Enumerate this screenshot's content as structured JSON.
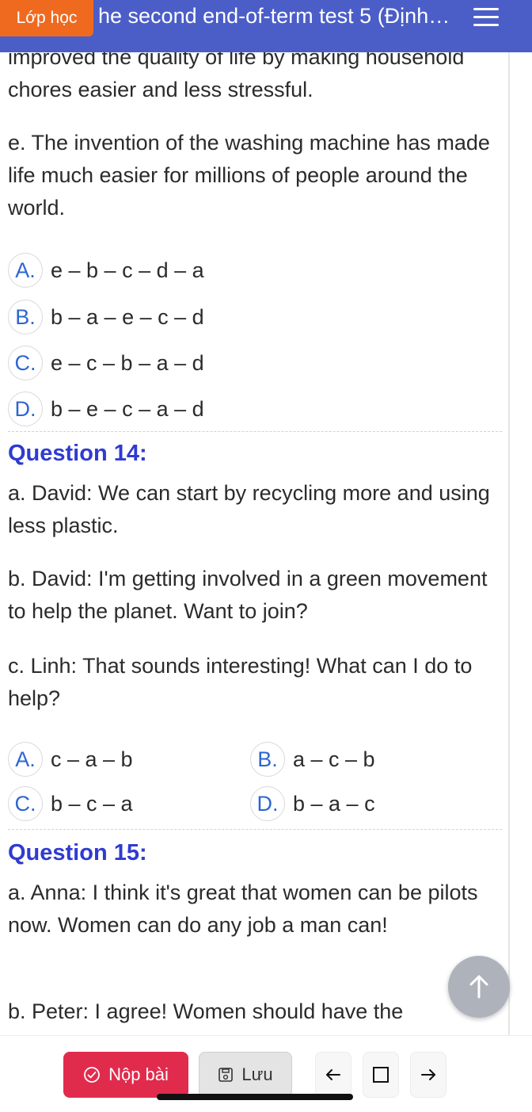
{
  "header": {
    "badge": "Lớp học",
    "title": "he second end-of-term test 5 (Định…"
  },
  "prev_paragraphs": [
    "improved the quality of life by making household chores easier and less stressful.",
    "e. The invention of the washing machine has made life much easier for millions of people around the world."
  ],
  "question13_options": [
    {
      "letter": "A.",
      "text": "e – b – c – d – a"
    },
    {
      "letter": "B.",
      "text": "b – a – e – c – d"
    },
    {
      "letter": "C.",
      "text": "e – c – b – a – d"
    },
    {
      "letter": "D.",
      "text": "b – e – c – a – d"
    }
  ],
  "question14": {
    "title": "Question 14:",
    "lines": [
      "a. David: We can start by recycling more and using less plastic.",
      "b. David: I'm getting involved in a green movement to help the planet. Want to join?",
      "c. Linh: That sounds interesting! What can I do to help?"
    ],
    "options": [
      {
        "letter": "A.",
        "text": "c – a – b"
      },
      {
        "letter": "B.",
        "text": "a – c – b"
      },
      {
        "letter": "C.",
        "text": "b – c – a"
      },
      {
        "letter": "D.",
        "text": "b – a – c"
      }
    ]
  },
  "question15": {
    "title": "Question 15:",
    "lines": [
      "a. Anna: I think it's great that women can be pilots now. Women can do any job a man can!",
      "b. Peter: I agree! Women should have the"
    ]
  },
  "bottom": {
    "submit_label": "Nộp bài",
    "save_label": "Lưu"
  },
  "colors": {
    "header_bg": "#4b5ec8",
    "badge_bg": "#ef6a1f",
    "question_title": "#2f3bd0",
    "option_letter": "#2d66d4",
    "submit_bg": "#e12b4d"
  }
}
